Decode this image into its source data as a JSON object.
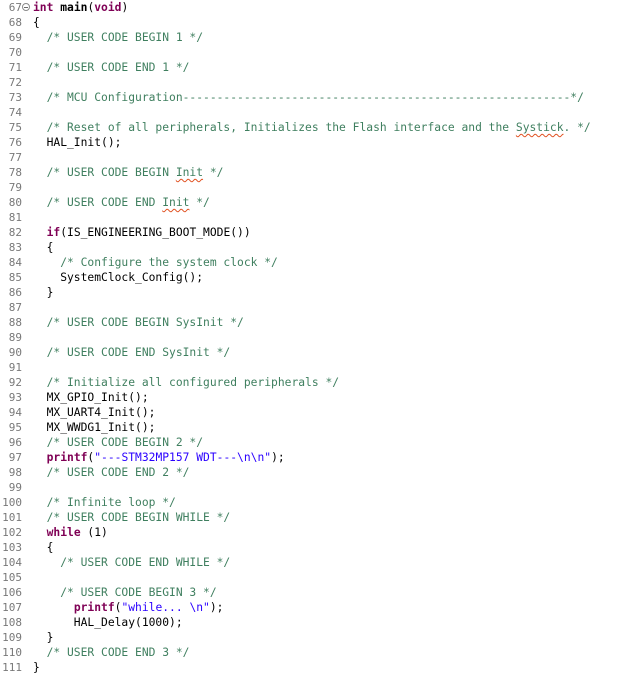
{
  "editor": {
    "lines": [
      {
        "n": "67",
        "fold": true,
        "segs": [
          {
            "t": "int ",
            "c": "kw"
          },
          {
            "t": "main",
            "c": "fn"
          },
          {
            "t": "(",
            "c": ""
          },
          {
            "t": "void",
            "c": "kw"
          },
          {
            "t": ")",
            "c": ""
          }
        ]
      },
      {
        "n": "68",
        "segs": [
          {
            "t": "{",
            "c": ""
          }
        ]
      },
      {
        "n": "69",
        "segs": [
          {
            "t": "  /* USER CODE BEGIN 1 */",
            "c": "cm"
          }
        ]
      },
      {
        "n": "70",
        "segs": []
      },
      {
        "n": "71",
        "segs": [
          {
            "t": "  /* USER CODE END 1 */",
            "c": "cm"
          }
        ]
      },
      {
        "n": "72",
        "segs": []
      },
      {
        "n": "73",
        "segs": [
          {
            "t": "  /* MCU Configuration---------------------------------------------------------*/",
            "c": "cm"
          }
        ]
      },
      {
        "n": "74",
        "segs": []
      },
      {
        "n": "75",
        "segs": [
          {
            "t": "  /* Reset of all peripherals, Initializes the Flash interface and the ",
            "c": "cm"
          },
          {
            "t": "Systick",
            "c": "cm spell"
          },
          {
            "t": ". */",
            "c": "cm"
          }
        ]
      },
      {
        "n": "76",
        "segs": [
          {
            "t": "  HAL_Init();",
            "c": ""
          }
        ]
      },
      {
        "n": "77",
        "segs": []
      },
      {
        "n": "78",
        "segs": [
          {
            "t": "  /* USER CODE BEGIN ",
            "c": "cm"
          },
          {
            "t": "Init",
            "c": "cm spell"
          },
          {
            "t": " */",
            "c": "cm"
          }
        ]
      },
      {
        "n": "79",
        "segs": []
      },
      {
        "n": "80",
        "segs": [
          {
            "t": "  /* USER CODE END ",
            "c": "cm"
          },
          {
            "t": "Init",
            "c": "cm spell"
          },
          {
            "t": " */",
            "c": "cm"
          }
        ]
      },
      {
        "n": "81",
        "segs": []
      },
      {
        "n": "82",
        "segs": [
          {
            "t": "  ",
            "c": ""
          },
          {
            "t": "if",
            "c": "kw"
          },
          {
            "t": "(IS_ENGINEERING_BOOT_MODE())",
            "c": ""
          }
        ]
      },
      {
        "n": "83",
        "segs": [
          {
            "t": "  {",
            "c": ""
          }
        ]
      },
      {
        "n": "84",
        "segs": [
          {
            "t": "    /* Configure the system clock */",
            "c": "cm"
          }
        ]
      },
      {
        "n": "85",
        "segs": [
          {
            "t": "    SystemClock_Config();",
            "c": ""
          }
        ]
      },
      {
        "n": "86",
        "segs": [
          {
            "t": "  }",
            "c": ""
          }
        ]
      },
      {
        "n": "87",
        "segs": []
      },
      {
        "n": "88",
        "segs": [
          {
            "t": "  /* USER CODE BEGIN SysInit */",
            "c": "cm"
          }
        ]
      },
      {
        "n": "89",
        "segs": []
      },
      {
        "n": "90",
        "segs": [
          {
            "t": "  /* USER CODE END SysInit */",
            "c": "cm"
          }
        ]
      },
      {
        "n": "91",
        "segs": []
      },
      {
        "n": "92",
        "segs": [
          {
            "t": "  /* Initialize all configured peripherals */",
            "c": "cm"
          }
        ]
      },
      {
        "n": "93",
        "segs": [
          {
            "t": "  MX_GPIO_Init();",
            "c": ""
          }
        ]
      },
      {
        "n": "94",
        "segs": [
          {
            "t": "  MX_UART4_Init();",
            "c": ""
          }
        ]
      },
      {
        "n": "95",
        "segs": [
          {
            "t": "  MX_WWDG1_Init();",
            "c": ""
          }
        ]
      },
      {
        "n": "96",
        "segs": [
          {
            "t": "  /* USER CODE BEGIN 2 */",
            "c": "cm"
          }
        ]
      },
      {
        "n": "97",
        "segs": [
          {
            "t": "  ",
            "c": ""
          },
          {
            "t": "printf",
            "c": "kw"
          },
          {
            "t": "(",
            "c": ""
          },
          {
            "t": "\"---STM32MP157 WDT---\\n\\n\"",
            "c": "str"
          },
          {
            "t": ");",
            "c": ""
          }
        ]
      },
      {
        "n": "98",
        "segs": [
          {
            "t": "  /* USER CODE END 2 */",
            "c": "cm"
          }
        ]
      },
      {
        "n": "99",
        "segs": []
      },
      {
        "n": "100",
        "segs": [
          {
            "t": "  /* Infinite loop */",
            "c": "cm"
          }
        ]
      },
      {
        "n": "101",
        "segs": [
          {
            "t": "  /* USER CODE BEGIN WHILE */",
            "c": "cm"
          }
        ]
      },
      {
        "n": "102",
        "segs": [
          {
            "t": "  ",
            "c": ""
          },
          {
            "t": "while",
            "c": "kw"
          },
          {
            "t": " (1)",
            "c": ""
          }
        ]
      },
      {
        "n": "103",
        "segs": [
          {
            "t": "  {",
            "c": ""
          }
        ]
      },
      {
        "n": "104",
        "segs": [
          {
            "t": "    /* USER CODE END WHILE */",
            "c": "cm"
          }
        ]
      },
      {
        "n": "105",
        "segs": []
      },
      {
        "n": "106",
        "segs": [
          {
            "t": "    /* USER CODE BEGIN 3 */",
            "c": "cm"
          }
        ]
      },
      {
        "n": "107",
        "segs": [
          {
            "t": "      ",
            "c": ""
          },
          {
            "t": "printf",
            "c": "kw"
          },
          {
            "t": "(",
            "c": ""
          },
          {
            "t": "\"while... \\n\"",
            "c": "str"
          },
          {
            "t": ");",
            "c": ""
          }
        ]
      },
      {
        "n": "108",
        "segs": [
          {
            "t": "      HAL_Delay(1000);",
            "c": ""
          }
        ]
      },
      {
        "n": "109",
        "segs": [
          {
            "t": "  }",
            "c": ""
          }
        ]
      },
      {
        "n": "110",
        "segs": [
          {
            "t": "  /* USER CODE END 3 */",
            "c": "cm"
          }
        ]
      },
      {
        "n": "111",
        "segs": [
          {
            "t": "}",
            "c": ""
          }
        ]
      }
    ]
  }
}
